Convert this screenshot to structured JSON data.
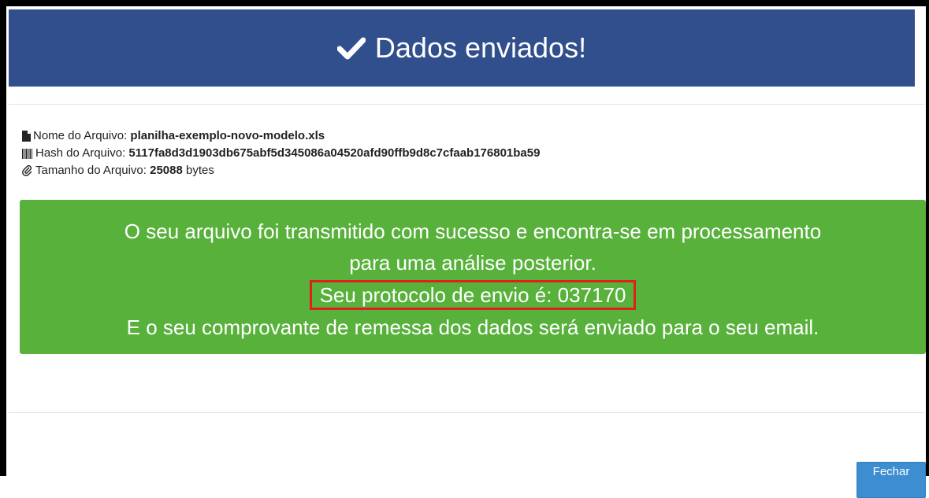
{
  "modal": {
    "title": "Dados enviados!",
    "title_icon": "check-icon",
    "header_color": "#314f8c"
  },
  "file_info": {
    "name_label": "Nome do Arquivo:",
    "name_value": "planilha-exemplo-novo-modelo.xls",
    "name_icon": "file-icon",
    "hash_label": "Hash do Arquivo:",
    "hash_value": "5117fa8d3d1903db675abf5d345086a04520afd90ffb9d8c7cfaab176801ba59",
    "hash_icon": "barcode-icon",
    "size_label": "Tamanho do Arquivo:",
    "size_value": "25088",
    "size_unit": "bytes",
    "size_icon": "paperclip-icon"
  },
  "success": {
    "color": "#58b13b",
    "line1": "O seu arquivo foi transmitido com sucesso e encontra-se em processamento",
    "line2": "para uma análise posterior.",
    "protocol": "Seu protocolo de envio é: 037170",
    "line4": "E o seu comprovante de remessa dos dados será enviado para o seu email."
  },
  "footer": {
    "close_label": "Fechar",
    "close_color": "#3c8ed1"
  }
}
